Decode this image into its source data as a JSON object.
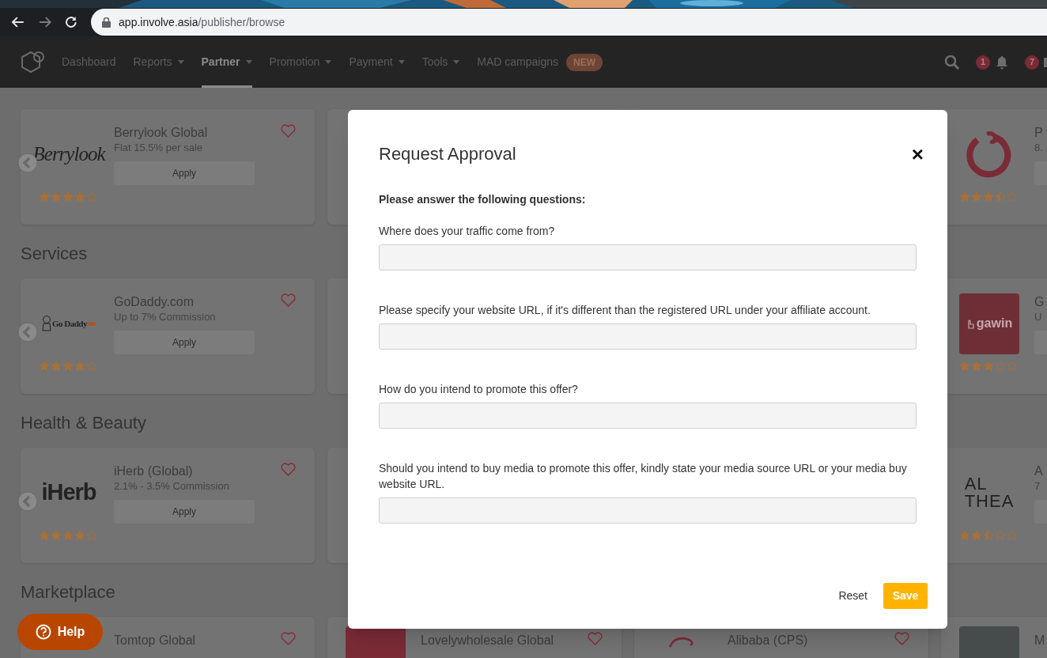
{
  "browser": {
    "url_host": "app.involve.asia",
    "url_path": "/publisher/browse"
  },
  "nav": {
    "items": [
      {
        "label": "Dashboard",
        "dropdown": false,
        "selected": false
      },
      {
        "label": "Reports",
        "dropdown": true,
        "selected": false
      },
      {
        "label": "Partner",
        "dropdown": true,
        "selected": true
      },
      {
        "label": "Promotion",
        "dropdown": true,
        "selected": false
      },
      {
        "label": "Payment",
        "dropdown": true,
        "selected": false
      },
      {
        "label": "Tools",
        "dropdown": true,
        "selected": false
      },
      {
        "label": "MAD campaigns",
        "dropdown": false,
        "selected": false,
        "badge": "NEW"
      }
    ],
    "alerts": [
      {
        "kind": "bell",
        "count": "1"
      },
      {
        "kind": "mail",
        "count": "7"
      }
    ]
  },
  "sections": [
    {
      "cards": [
        {
          "title": "Berrylook Global",
          "subtitle": "Flat 15.5% per sale",
          "button": "Apply",
          "logo": {
            "kind": "script",
            "text": "Berrylook"
          },
          "stars": 4,
          "heart": true,
          "arrow": true
        },
        {
          "covered": true
        },
        {
          "covered": true
        },
        {
          "title": "P",
          "subtitle": "8.",
          "logo": {
            "kind": "ring"
          },
          "stars": 3.5,
          "heart": false,
          "arrow": false,
          "button_stub": true
        }
      ]
    },
    {
      "heading": "Services",
      "cards": [
        {
          "title": "GoDaddy.com",
          "subtitle": "Up to 7% Commission",
          "button": "Apply",
          "logo": {
            "kind": "mascot",
            "text": "Go Daddy"
          },
          "stars": 4,
          "heart": true,
          "arrow": true
        },
        {
          "covered": true
        },
        {
          "title": "G",
          "subtitle": "U",
          "logo": {
            "kind": "tile",
            "text": "gawin"
          },
          "stars": 3,
          "heart": false,
          "arrow": false,
          "button_stub": true
        }
      ]
    },
    {
      "heading": "Health & Beauty",
      "cards": [
        {
          "title": "iHerb (Global)",
          "subtitle": "2.1% - 3.5% Commission",
          "button": "Apply",
          "logo": {
            "kind": "bold",
            "text": "iHerb"
          },
          "stars": 4,
          "heart": true,
          "arrow": true
        },
        {
          "covered": true
        },
        {
          "title": "A",
          "subtitle": "7",
          "logo": {
            "kind": "thin",
            "lines": [
              "AL",
              "THEA"
            ]
          },
          "stars": 2.5,
          "heart": false,
          "arrow": false,
          "button_stub": true
        }
      ]
    },
    {
      "heading": "Marketplace",
      "cards": [
        {
          "title": "Tomtop Global",
          "heart": true,
          "arrow": false
        },
        {
          "title": "Lovelywholesale Global",
          "logo": {
            "kind": "square",
            "color": "#7a2b36"
          },
          "heart": true,
          "arrow": false
        },
        {
          "title": "Alibaba (CPS)",
          "logo": {
            "kind": "swirl"
          },
          "heart": true,
          "arrow": false
        },
        {
          "title": "M",
          "logo": {
            "kind": "square",
            "color": "#464b4b"
          },
          "heart": false,
          "arrow": false
        }
      ]
    }
  ],
  "modal": {
    "title": "Request Approval",
    "close": "×",
    "intro": "Please answer the following questions:",
    "questions": [
      {
        "label": "Where does your traffic come from?"
      },
      {
        "label": "Please specify your website URL, if it's different than the registered URL under your affiliate account."
      },
      {
        "label": "How do you intend to promote this offer?"
      },
      {
        "label": "Should you intend to buy media to promote this offer, kindly state your media source URL or your media buy website URL."
      }
    ],
    "reset": "Reset",
    "save": "Save"
  },
  "help": {
    "label": "Help"
  }
}
